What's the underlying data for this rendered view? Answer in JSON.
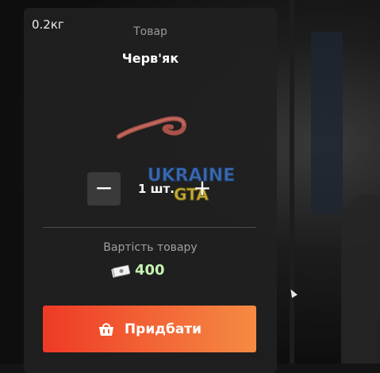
{
  "product": {
    "weight": "0.2кг",
    "subtitle": "Товар",
    "title": "Черв'як"
  },
  "quantity": {
    "minus_label": "−",
    "value": "1 шт.",
    "plus_label": "+"
  },
  "price": {
    "label": "Вартість товару",
    "value": "400"
  },
  "buy_button": {
    "label": "Придбати"
  },
  "watermark": {
    "line1": "UKRAINE",
    "line2": "GTA"
  },
  "colors": {
    "panel": "#202020",
    "price": "#c7f3b4",
    "button_start": "#ee3a26",
    "button_end": "#f48b42"
  },
  "icons": [
    "worm-image",
    "money-icon",
    "basket-icon"
  ]
}
